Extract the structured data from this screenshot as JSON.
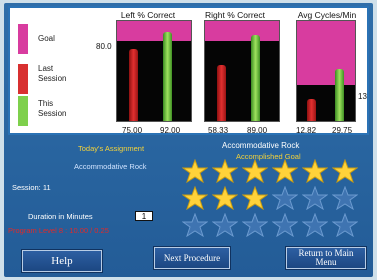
{
  "legend": {
    "goal": "Goal",
    "last_session": "Last Session",
    "this_session": "This Session"
  },
  "charts": {
    "left": {
      "title": "Left % Correct",
      "goal_label": "80.0",
      "last": "75.00",
      "this": "92.00"
    },
    "right": {
      "title": "Right % Correct",
      "last": "58.33",
      "this": "89.00"
    },
    "avg": {
      "title": "Avg Cycles/Min",
      "goal_label": "13",
      "last": "12.82",
      "this": "29.75"
    }
  },
  "assignment": {
    "heading": "Today's Assignment",
    "name": "Accommodative Rock",
    "session": "Session: 11",
    "duration_label": "Duration in Minutes",
    "duration_value": "1",
    "progress_text": "Program Level 8 : 10.00 / 0.25"
  },
  "goal": {
    "title": "Accommodative Rock",
    "subtitle": "Accomplished Goal",
    "stars_earned": 9,
    "stars_total": 18
  },
  "buttons": {
    "help": "Help",
    "next": "Next Procedure",
    "return": "Return to Main Menu"
  },
  "colors": {
    "goal": "#d83c9f",
    "last_session": "#d83030",
    "this_session": "#7ed04c",
    "star_gold": "#ffd23a",
    "star_empty": "#3f74b1",
    "accent_yellow": "#f3d23a",
    "accent_red": "#e02a2a"
  }
}
